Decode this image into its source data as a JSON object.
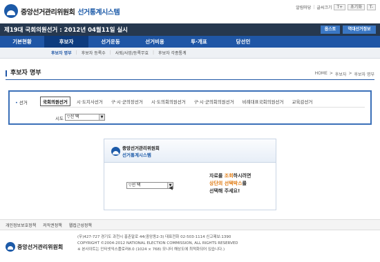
{
  "header": {
    "org_name": "중앙선거관리위원회",
    "system_name": "선거통계시스템",
    "util_links": [
      "알림마당",
      "글씨크기"
    ],
    "font_plus": "T+",
    "font_reset": "초기화",
    "font_minus": "T-"
  },
  "election_bar": {
    "title": "제19대 국회의원선거 : 2012년 04월11일 실시",
    "change_button": "옵스토",
    "history_button": "역대선거정보"
  },
  "main_nav": [
    "기본현황",
    "후보자",
    "선거운동",
    "선거비용",
    "투·개표",
    "당선인"
  ],
  "main_nav_active": 1,
  "sub_nav": [
    "후보자 명부",
    "후보자 등록수",
    "사퇴/사망/등록무효",
    "후보자 각종통계"
  ],
  "page": {
    "title": "후보자 명부",
    "breadcrumb": [
      "HOME",
      ">",
      "후보자",
      ">",
      "후보자 명부"
    ]
  },
  "selector": {
    "label": "선거",
    "election_types": [
      "국회의원선거",
      "시·도지사선거",
      "구·시·군의장선거",
      "시·도의회의원선거",
      "구·시·군의회의원선거",
      "비례대표국회의원선거",
      "교육감선거"
    ],
    "active_type": 0,
    "sido_label": "시도",
    "sido_value": "▽선 택"
  },
  "guide": {
    "org_name": "중앙선거관리위원회",
    "system_name": "선거통계시스템",
    "select_value": "▽선 택",
    "msg_line1_a": "자료를 ",
    "msg_line1_hl": "조회",
    "msg_line1_b": "하시려면",
    "msg_line2_hl": "상단의 선택박스",
    "msg_line2_b": "를",
    "msg_line3": "선택해 주세요!"
  },
  "footer": {
    "links": [
      "개인정보보호정책",
      "저작권정책",
      "웹접근성정책"
    ],
    "org_name": "중앙선거관리위원회",
    "address": "(우)427-727 경기도 과천시 홍촌말로 44(중앙동2-3) 대표전화 02-503-1114 신고제보:1390",
    "copyright": "COPYRIGHT ©2004-2012 NATIONAL ELECTION COMMISSION, ALL RIGHTS RESERVED",
    "notice": "※ 본사이트는 인터넷익스플로러8.0 (1024 × 768) 모니터 해상도에 최적화되어 있습니다.)"
  },
  "colors": {
    "brand_blue": "#1f56a6",
    "title_bar": "#26384f",
    "highlight": "#e07a10"
  }
}
